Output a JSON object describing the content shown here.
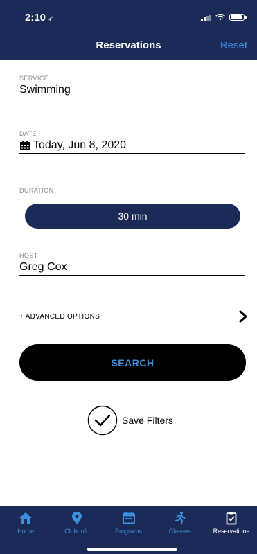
{
  "status_bar": {
    "time": "2:10",
    "location_glyph": "➶"
  },
  "navbar": {
    "title": "Reservations",
    "reset_label": "Reset"
  },
  "form": {
    "service": {
      "label": "SERVICE",
      "value": "Swimming"
    },
    "date": {
      "label": "DATE",
      "value": "Today, Jun 8, 2020",
      "icon": "calendar-icon"
    },
    "duration": {
      "label": "DURATION",
      "value": "30 min"
    },
    "host": {
      "label": "HOST",
      "value": "Greg Cox"
    }
  },
  "advanced_options": {
    "label": "+ ADVANCED OPTIONS",
    "icon": "chevron-right-icon"
  },
  "search_button": {
    "label": "SEARCH"
  },
  "save_filters": {
    "label": "Save Filters",
    "checked": true
  },
  "tabs": [
    {
      "label": "Home",
      "icon": "home-icon"
    },
    {
      "label": "Club Info",
      "icon": "map-pin-icon"
    },
    {
      "label": "Programs",
      "icon": "calendar-icon"
    },
    {
      "label": "Classes",
      "icon": "running-icon"
    },
    {
      "label": "Reservations",
      "icon": "clipboard-check-icon"
    }
  ],
  "colors": {
    "primary": "#1c2a57",
    "accent": "#3b8fe0",
    "button": "#000000"
  }
}
